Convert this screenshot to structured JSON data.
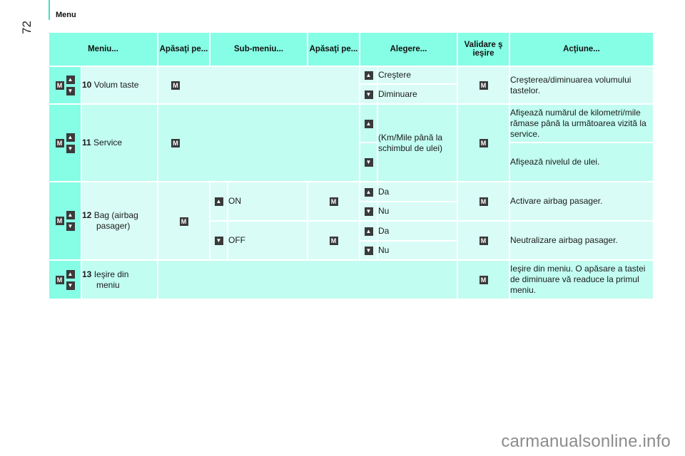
{
  "page": {
    "section_title": "Menu",
    "page_number": "72",
    "watermark": "carmanualsonline.info"
  },
  "icons": {
    "m_key": "M",
    "up_arrow": "▲",
    "down_arrow": "▼"
  },
  "table": {
    "headers": [
      "Meniu...",
      "Apăsaţi pe...",
      "Sub-meniu...",
      "Apăsaţi pe...",
      "Alegere...",
      "Validare ş ieşire",
      "Acţiune..."
    ],
    "rows": [
      {
        "number": "10",
        "name": "Volum taste",
        "choices": [
          {
            "arrow": "up",
            "label": "Creştere"
          },
          {
            "arrow": "down",
            "label": "Diminuare"
          }
        ],
        "action": "Creşterea/diminuarea volumului tastelor."
      },
      {
        "number": "11",
        "name": "Service",
        "choice_label": "(Km/Mile până la schimbul de ulei)",
        "actions": [
          "Afişează numărul de kilometri/mile rămase până la următoarea vizită la service.",
          "Afişează nivelul de ulei."
        ]
      },
      {
        "number": "12",
        "name": "Bag (airbag",
        "name_line2": "pasager)",
        "submenus": [
          {
            "arrow": "up",
            "label": "ON",
            "choices": [
              {
                "arrow": "up",
                "label": "Da"
              },
              {
                "arrow": "down",
                "label": "Nu"
              }
            ],
            "action": "Activare airbag pasager."
          },
          {
            "arrow": "down",
            "label": "OFF",
            "choices": [
              {
                "arrow": "up",
                "label": "Da"
              },
              {
                "arrow": "down",
                "label": "Nu"
              }
            ],
            "action": "Neutralizare airbag pasager."
          }
        ]
      },
      {
        "number": "13",
        "name": "Ieşire din",
        "name_line2": "meniu",
        "action": "Ieşire din meniu. O apăsare a tastei de diminuare vă readuce la primul meniu."
      }
    ]
  },
  "colors": {
    "header": "#86fde5",
    "row_light": "#d9fdf6",
    "row_alt": "#c2fdf1",
    "icon": "#3a3a3a",
    "accent_bar": "#3fe0c8"
  }
}
